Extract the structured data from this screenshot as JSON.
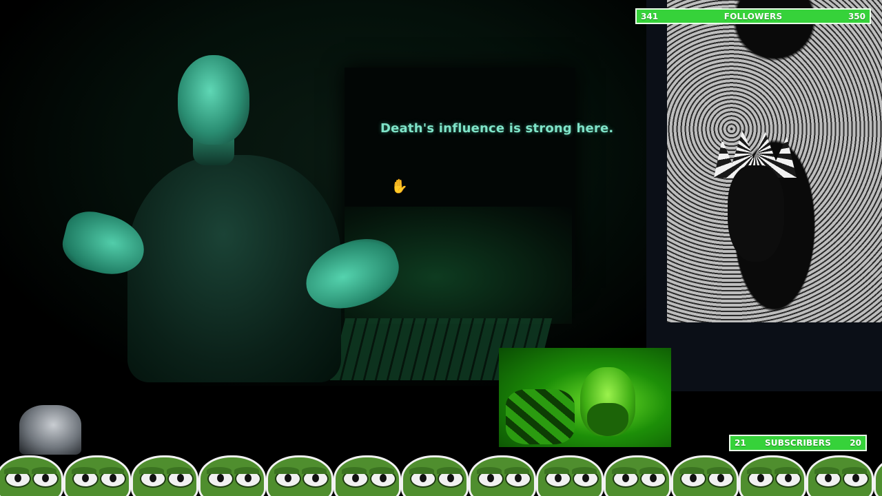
{
  "game": {
    "dialogue_text": "Death's influence is strong here."
  },
  "follower_goal": {
    "current": "341",
    "label": "FOLLOWERS",
    "target": "350",
    "accent_color": "#36d23a"
  },
  "subscriber_goal": {
    "current": "21",
    "label": "SUBSCRIBERS",
    "target": "20",
    "accent_color": "#36d23a"
  },
  "overlay": {
    "webcam": "webcam-feed",
    "manga_panel": "manga-artwork",
    "frog_row": "pepe-frog-emotes",
    "cursor_icon": "hand-cursor-icon"
  }
}
